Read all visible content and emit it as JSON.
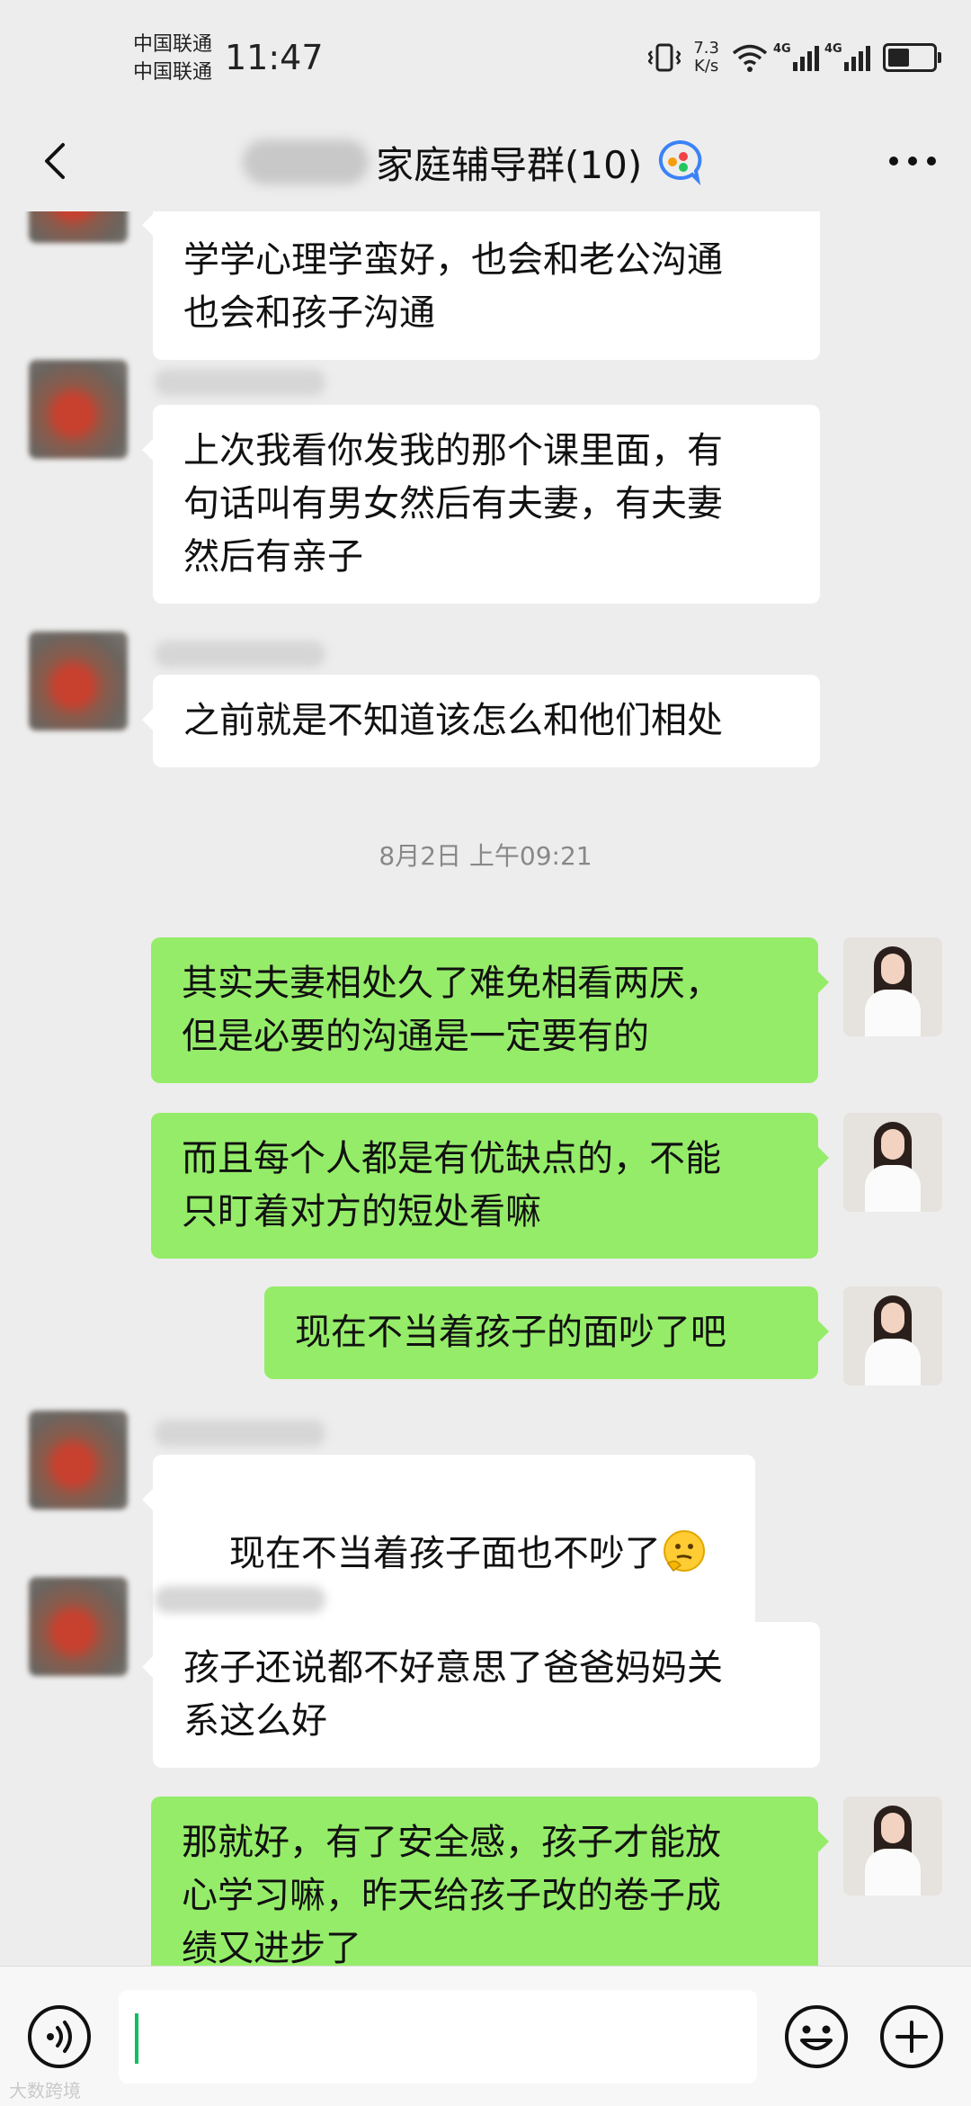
{
  "status_bar": {
    "carrier_1": "中国联通",
    "carrier_2": "中国联通",
    "time": "11:47",
    "net_speed_value": "7.3",
    "net_speed_unit": "K/s",
    "signal_label_1": "4G",
    "signal_label_2": "4G",
    "battery_level": 0.55
  },
  "header": {
    "title": "家庭辅导群(10)",
    "back_icon": "chevron-left-icon",
    "more_icon": "more-dots-icon"
  },
  "messages": [
    {
      "side": "left",
      "text": "学学心理学蛮好，也会和老公沟通\n也会和孩子沟通"
    },
    {
      "side": "left",
      "text": "上次我看你发我的那个课里面，有\n句话叫有男女然后有夫妻，有夫妻\n然后有亲子"
    },
    {
      "side": "left",
      "text": "之前就是不知道该怎么和他们相处"
    },
    {
      "side": "time",
      "text": "8月2日 上午09:21"
    },
    {
      "side": "right",
      "text": "其实夫妻相处久了难免相看两厌，\n但是必要的沟通是一定要有的"
    },
    {
      "side": "right",
      "text": "而且每个人都是有优缺点的，不能\n只盯着对方的短处看嘛"
    },
    {
      "side": "right",
      "text": "现在不当着孩子的面吵了吧"
    },
    {
      "side": "left",
      "text": "现在不当着孩子面也不吵了",
      "emoji": "thinking-face-icon"
    },
    {
      "side": "left",
      "text": "孩子还说都不好意思了爸爸妈妈关\n系这么好"
    },
    {
      "side": "right",
      "text": "那就好，有了安全感，孩子才能放\n心学习嘛，昨天给孩子改的卷子成\n绩又进步了"
    }
  ],
  "input_bar": {
    "voice_icon": "voice-icon",
    "emoji_icon": "emoji-icon",
    "plus_icon": "plus-icon"
  },
  "watermark": "大数跨境",
  "colors": {
    "background": "#ededed",
    "bubble_self": "#95ec69",
    "bubble_other": "#ffffff",
    "caret": "#07c160"
  }
}
